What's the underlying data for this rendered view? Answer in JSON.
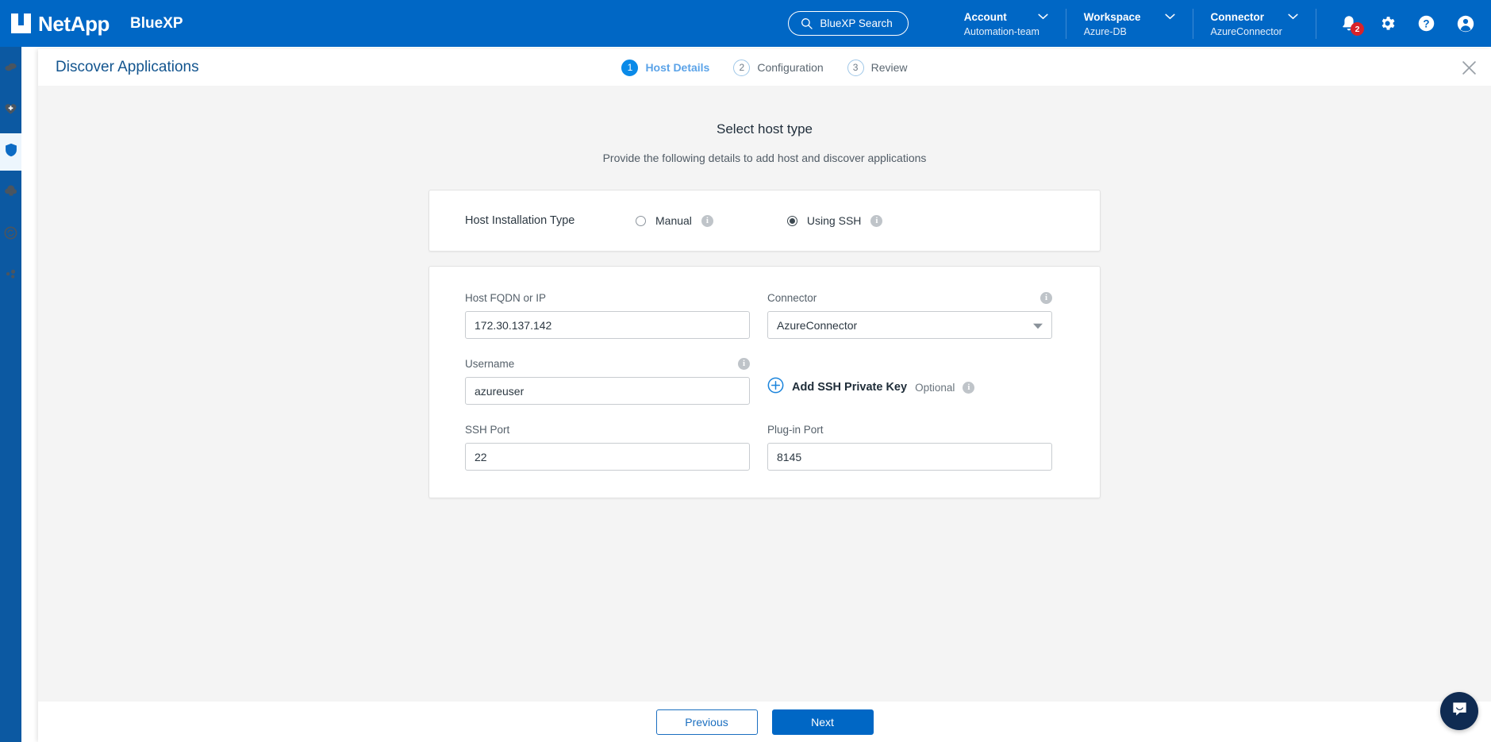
{
  "topbar": {
    "brand": "NetApp",
    "product": "BlueXP",
    "search_label": "BlueXP Search",
    "search_icon": "search-icon",
    "context": [
      {
        "label": "Account",
        "value": "Automation-team",
        "icon": "chevron-down-icon"
      },
      {
        "label": "Workspace",
        "value": "Azure-DB",
        "icon": "chevron-down-icon"
      },
      {
        "label": "Connector",
        "value": "AzureConnector",
        "icon": "chevron-down-icon"
      }
    ],
    "icons": {
      "notifications": "bell-icon",
      "notifications_count": "2",
      "settings": "gear-icon",
      "help": "help-icon",
      "profile": "user-avatar-icon"
    },
    "accent": "#0067C5",
    "badge_color": "#D8232A"
  },
  "sidebar": {
    "items": [
      {
        "name": "canvas",
        "icon": "canvas-icon",
        "active": false
      },
      {
        "name": "health",
        "icon": "health-heart-icon",
        "active": false
      },
      {
        "name": "protection",
        "icon": "shield-icon",
        "active": true
      },
      {
        "name": "governance",
        "icon": "cloud-lock-icon",
        "active": false
      },
      {
        "name": "mobility",
        "icon": "sync-icon",
        "active": false
      },
      {
        "name": "extensions",
        "icon": "nodes-icon",
        "active": false
      }
    ],
    "active_color": "#0067C5"
  },
  "wizard": {
    "title": "Discover Applications",
    "close_icon": "close-icon",
    "steps": [
      {
        "number": "1",
        "label": "Host Details",
        "state": "current"
      },
      {
        "number": "2",
        "label": "Configuration",
        "state": "pending"
      },
      {
        "number": "3",
        "label": "Review",
        "state": "pending"
      }
    ]
  },
  "content": {
    "title": "Select host type",
    "subtitle": "Provide the following details to add host and discover applications",
    "install_type": {
      "label": "Host Installation Type",
      "options": [
        {
          "label": "Manual",
          "selected": false,
          "info_icon": "info-icon"
        },
        {
          "label": "Using SSH",
          "selected": true,
          "info_icon": "info-icon"
        }
      ]
    },
    "fields": {
      "host_fqdn": {
        "label": "Host FQDN or IP",
        "value": "172.30.137.142",
        "placeholder": ""
      },
      "connector": {
        "label": "Connector",
        "value": "AzureConnector",
        "info_icon": "info-icon",
        "caret_icon": "chevron-down-icon"
      },
      "username": {
        "label": "Username",
        "value": "azureuser",
        "info_icon": "info-icon",
        "placeholder": ""
      },
      "ssh_port": {
        "label": "SSH Port",
        "value": "22",
        "placeholder": ""
      },
      "plugin_port": {
        "label": "Plug-in Port",
        "value": "8145",
        "placeholder": ""
      }
    },
    "add_ssh_key": {
      "label": "Add SSH Private Key",
      "optional": "Optional",
      "plus_icon": "plus-circle-icon",
      "info_icon": "info-icon"
    }
  },
  "footer": {
    "previous_label": "Previous",
    "next_label": "Next"
  },
  "chat": {
    "icon": "chat-bubble-icon"
  }
}
